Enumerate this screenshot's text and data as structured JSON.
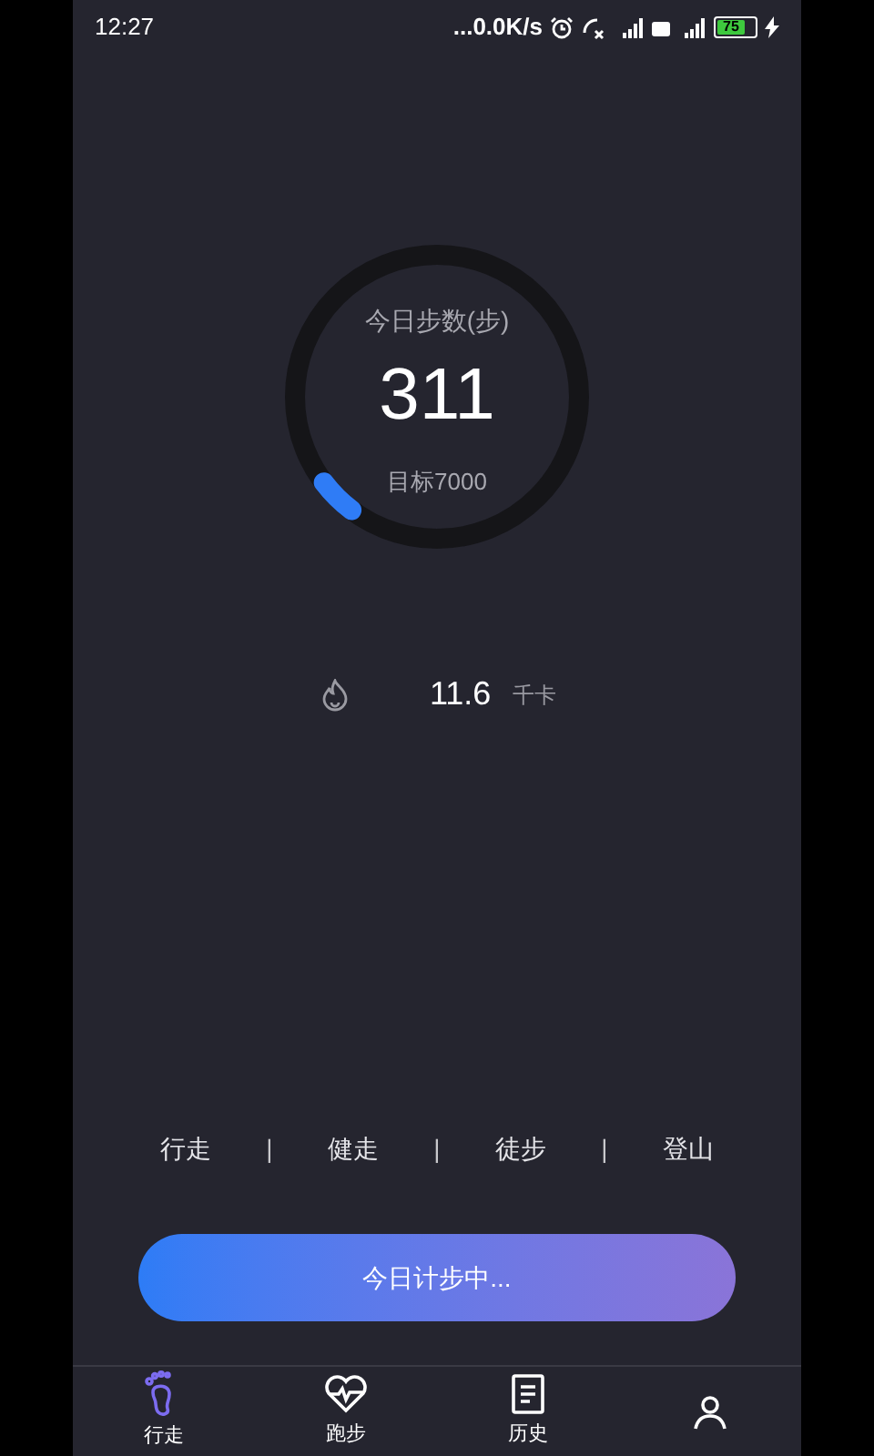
{
  "status_bar": {
    "time": "12:27",
    "dots": "...",
    "speed": "0.0K/s",
    "battery": {
      "text": "75",
      "level": 0.75
    }
  },
  "ring": {
    "title": "今日步数(步)",
    "steps": "311",
    "goal": "目标7000",
    "level": 0.044
  },
  "calories": {
    "value": "11.6",
    "unit": "千卡"
  },
  "modes": [
    {
      "label": "行走",
      "selected": false
    },
    {
      "label": "健走",
      "selected": false
    },
    {
      "label": "徒步",
      "selected": false
    },
    {
      "label": "登山",
      "selected": false
    }
  ],
  "separator": "|",
  "action_button": "今日计步中...",
  "tabs": [
    {
      "kind": "walk",
      "label": "行走",
      "selected": true
    },
    {
      "kind": "run",
      "label": "跑步",
      "selected": false
    },
    {
      "kind": "history",
      "label": "历史",
      "selected": false
    },
    {
      "kind": "me",
      "selected": false
    }
  ]
}
